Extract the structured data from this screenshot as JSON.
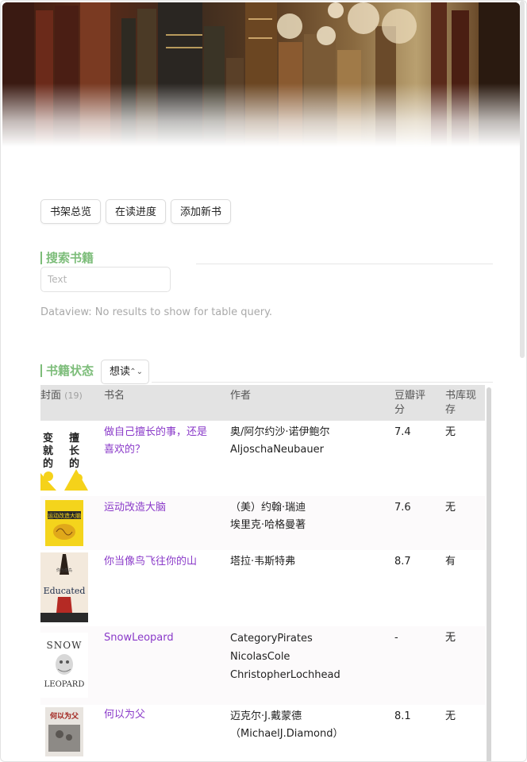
{
  "toolbar": {
    "buttons": [
      "书架总览",
      "在读进度",
      "添加新书"
    ]
  },
  "search": {
    "heading": "搜索书籍",
    "placeholder": "Text",
    "dataview_message": "Dataview: No results to show for table query."
  },
  "status": {
    "heading": "书籍状态",
    "filter_value": "想读"
  },
  "table": {
    "headers": {
      "cover": "封面",
      "cover_count": "(19)",
      "title": "书名",
      "author": "作者",
      "rating": "豆瓣评分",
      "stock": "书库现存"
    },
    "rows": [
      {
        "title": "做自己擅长的事，还是喜欢的？",
        "authors": [
          "奥/阿尔约沙·诺伊鲍尔",
          "AljoschaNeubauer"
        ],
        "rating": "7.4",
        "stock": "无",
        "cover_text": "变\n就\n的"
      },
      {
        "title": "运动改造大脑",
        "authors": [
          "（美）约翰·瑞迪",
          "埃里克·哈格曼著"
        ],
        "rating": "7.6",
        "stock": "无",
        "cover_text": "运动改造大脑"
      },
      {
        "title": "你当像鸟飞往你的山",
        "authors": [
          "塔拉·韦斯特弗"
        ],
        "rating": "8.7",
        "stock": "有",
        "cover_text": "Educated"
      },
      {
        "title": "SnowLeopard",
        "authors": [
          "CategoryPirates",
          "NicolasCole",
          "ChristopherLochhead"
        ],
        "rating": "-",
        "stock": "无",
        "cover_text_top": "SNOW",
        "cover_text_bottom": "LEOPARD"
      },
      {
        "title": "何以为父",
        "authors": [
          "迈克尔·J.戴蒙德",
          "（MichaelJ.Diamond）"
        ],
        "rating": "8.1",
        "stock": "无",
        "cover_text": "何以为父"
      }
    ]
  },
  "colors": {
    "heading_green": "#7dbd7a",
    "link_purple": "#8a3ac9",
    "header_bg": "#e3e3e3"
  }
}
